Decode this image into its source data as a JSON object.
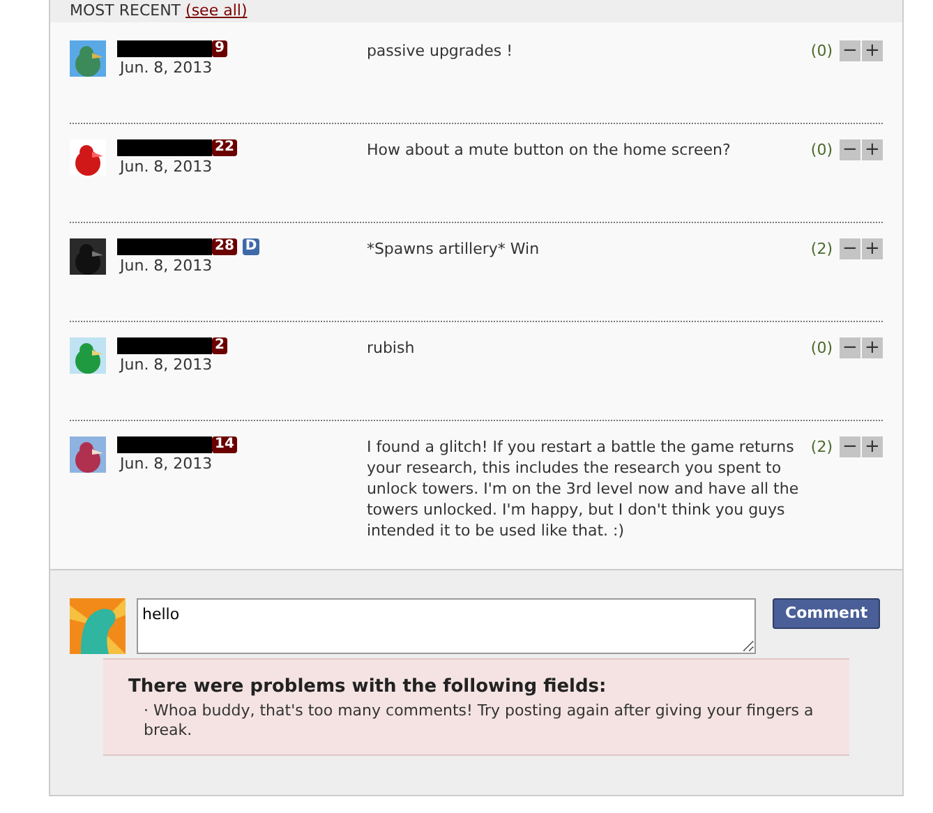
{
  "header": {
    "title": "MOST RECENT",
    "link": "(see all)"
  },
  "comments": [
    {
      "level": "9",
      "date": "Jun. 8, 2013",
      "text": "passive upgrades !",
      "score": "(0)"
    },
    {
      "level": "22",
      "date": "Jun. 8, 2013",
      "text": "How about a mute button on the home screen?",
      "score": "(0)"
    },
    {
      "level": "28",
      "extra_badge": "D",
      "date": "Jun. 8, 2013",
      "text": "*Spawns artillery* Win",
      "score": "(2)"
    },
    {
      "level": "2",
      "date": "Jun. 8, 2013",
      "text": "rubish",
      "score": "(0)"
    },
    {
      "level": "14",
      "date": "Jun. 8, 2013",
      "text": "I found a glitch! If you restart a battle the game returns your research, this includes the research you spent to unlock towers. I'm on the 3rd level now and have all the towers unlocked. I'm happy, but I don't think you guys intended it to be used like that. :)",
      "score": "(2)"
    }
  ],
  "vote_buttons": {
    "down": "−",
    "up": "+"
  },
  "compose": {
    "value": "hello",
    "button": "Comment"
  },
  "error": {
    "title": "There were problems with the following fields:",
    "items": [
      "· Whoa buddy, that's too many comments! Try posting again after giving your fingers a break."
    ]
  }
}
